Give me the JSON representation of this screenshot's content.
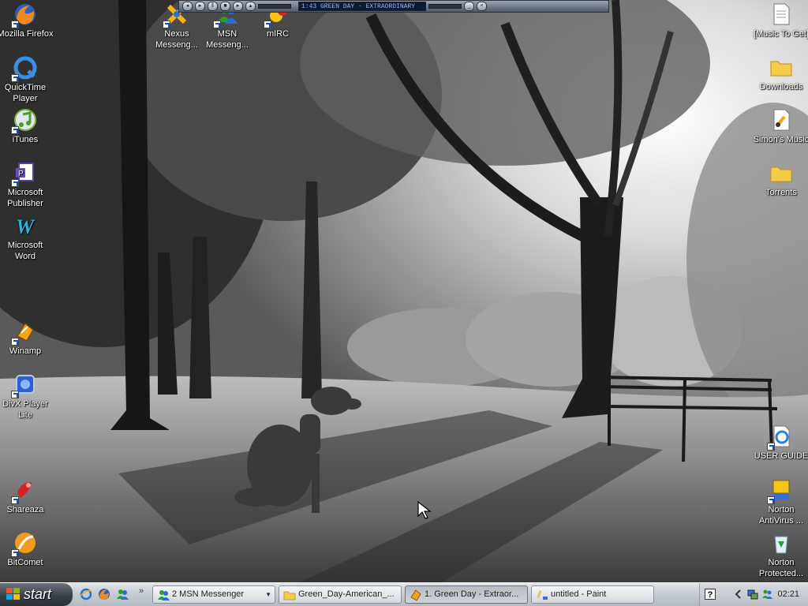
{
  "desktop": {
    "left_icons": [
      {
        "label": "Mozilla Firefox",
        "icon": "firefox-icon"
      },
      {
        "label": "QuickTime Player",
        "icon": "quicktime-icon"
      },
      {
        "label": "iTunes",
        "icon": "itunes-icon"
      },
      {
        "label": "Microsoft Publisher",
        "icon": "publisher-icon"
      },
      {
        "label": "Microsoft Word",
        "icon": "word-icon"
      },
      {
        "label": "Winamp",
        "icon": "winamp-icon"
      },
      {
        "label": "DivX Player Lite",
        "icon": "divx-icon"
      },
      {
        "label": "Shareaza",
        "icon": "shareaza-icon"
      },
      {
        "label": "BitComet",
        "icon": "bitcomet-icon"
      }
    ],
    "top_icons": [
      {
        "label": "Nexus Messeng...",
        "icon": "nexus-icon"
      },
      {
        "label": "MSN Messeng...",
        "icon": "msn-icon"
      },
      {
        "label": "mIRC",
        "icon": "mirc-icon"
      }
    ],
    "right_icons": [
      {
        "label": "[Music To Get]",
        "icon": "text-document-icon"
      },
      {
        "label": "Downloads",
        "icon": "folder-icon"
      },
      {
        "label": "Simon's Music",
        "icon": "music-file-icon"
      },
      {
        "label": "Torrents",
        "icon": "folder-icon"
      },
      {
        "label": "USER GUIDE",
        "icon": "ie-document-icon"
      },
      {
        "label": "Norton AntiVirus ...",
        "icon": "norton-antivirus-icon"
      },
      {
        "label": "Norton Protected...",
        "icon": "recycle-bin-icon"
      }
    ]
  },
  "winamp": {
    "display_text": "1:43  GREEN DAY - EXTRAORDINARY",
    "buttons": [
      "prev",
      "play",
      "pause",
      "stop",
      "next",
      "eject"
    ]
  },
  "taskbar": {
    "start_label": "start",
    "quick_launch": [
      "ie-icon",
      "firefox-icon",
      "msn-icon"
    ],
    "tasks": [
      {
        "label": "2 MSN Messenger",
        "icon": "msn-icon",
        "grouped": true,
        "active": false
      },
      {
        "label": "Green_Day-American_...",
        "icon": "folder-icon",
        "grouped": false,
        "active": false
      },
      {
        "label": "1. Green Day - Extraor...",
        "icon": "winamp-icon",
        "grouped": false,
        "active": true
      },
      {
        "label": "untitled - Paint",
        "icon": "paint-icon",
        "grouped": false,
        "active": false
      }
    ],
    "tray": {
      "icons": [
        "help-icon",
        "expand-arrow-icon",
        "network-icon",
        "msn-status-icon"
      ],
      "clock": "02:21"
    }
  }
}
